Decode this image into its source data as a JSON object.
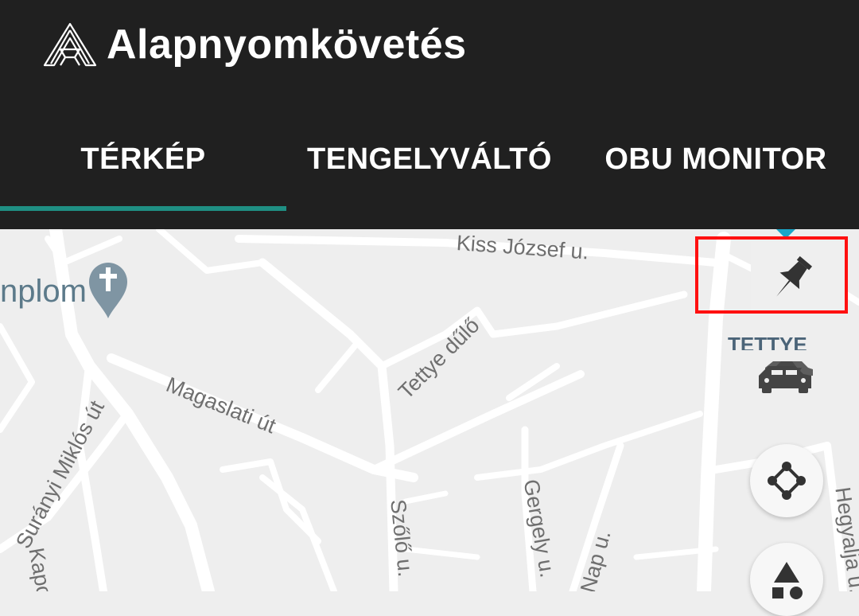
{
  "app": {
    "title": "Alapnyomkövetés"
  },
  "tabs": [
    {
      "label": "TÉRKÉP",
      "selected": true
    },
    {
      "label": "TENGELYVÁLTÓ",
      "selected": false
    },
    {
      "label": "OBU MONITOR",
      "selected": false
    }
  ],
  "colors": {
    "accent": "#1f8f83",
    "highlight": "#ff1010",
    "appbar": "#202020"
  },
  "map": {
    "streets": [
      {
        "name": "Kiss József u."
      },
      {
        "name": "Tettye dűlő"
      },
      {
        "name": "Magaslati út"
      },
      {
        "name": "Surányi Miklós út"
      },
      {
        "name": "Szőlő u."
      },
      {
        "name": "Gergely u."
      },
      {
        "name": "Nap u."
      },
      {
        "name": "Hegyalja u."
      },
      {
        "name": "Kapo"
      }
    ],
    "place": "nplom",
    "area_label": "TETTYE"
  },
  "controls": {
    "pin": "pushpin-icon",
    "traffic": "cars-icon",
    "route": "polygon-nodes-icon",
    "shapes": "shapes-icon"
  }
}
